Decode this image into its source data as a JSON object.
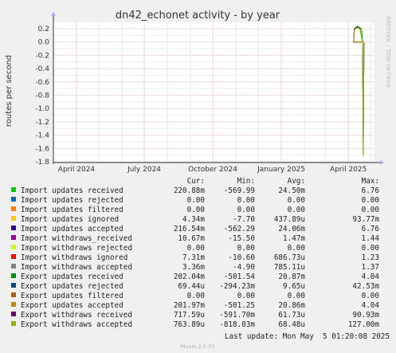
{
  "chart_data": {
    "type": "line",
    "title": "dn42_echonet activity - by year",
    "ylabel": "routes per second",
    "side_label": "RRDTOOL / TOBI OETIKER",
    "ylim": [
      -1.8,
      0.3
    ],
    "y_ticks": [
      0.2,
      0.0,
      -0.2,
      -0.4,
      -0.6,
      -0.8,
      -1.0,
      -1.2,
      -1.4,
      -1.6,
      -1.8
    ],
    "y_tick_labels": [
      "0.2",
      "0.0",
      "-0.2",
      "-0.4",
      "-0.6",
      "-0.8",
      "-1.0",
      "-1.2",
      "-1.4",
      "-1.6",
      "-1.8"
    ],
    "x_start": "2024-03-01",
    "x_end": "2025-05-05",
    "x_ticks": [
      {
        "label": "April 2024",
        "date": "2024-04-01"
      },
      {
        "label": "July 2024",
        "date": "2024-07-01"
      },
      {
        "label": "October 2024",
        "date": "2024-10-01"
      },
      {
        "label": "January 2025",
        "date": "2025-01-01"
      },
      {
        "label": "April 2025",
        "date": "2025-04-01"
      }
    ],
    "grid": true,
    "legend_header": {
      "cur": "Cur:",
      "min": "Min:",
      "avg": "Avg:",
      "max": "Max:"
    },
    "series": [
      {
        "name": "Import updates received",
        "color": "#00cc00",
        "cur": "220.88m",
        "min": "-569.99",
        "avg": "24.50m",
        "max": "6.76",
        "points": [
          [
            "2025-04-08",
            0.0
          ],
          [
            "2025-04-09",
            0.2
          ],
          [
            "2025-04-13",
            0.24
          ],
          [
            "2025-04-17",
            0.21
          ],
          [
            "2025-04-19",
            0.2
          ],
          [
            "2025-04-20",
            0.0
          ]
        ]
      },
      {
        "name": "Import updates rejected",
        "color": "#0066b3",
        "cur": "0.00",
        "min": "0.00",
        "avg": "0.00",
        "max": "0.00",
        "points": [
          [
            "2025-04-08",
            0.0
          ],
          [
            "2025-04-20",
            0.0
          ]
        ]
      },
      {
        "name": "Import updates filtered",
        "color": "#ff8000",
        "cur": "0.00",
        "min": "0.00",
        "avg": "0.00",
        "max": "0.00",
        "points": [
          [
            "2025-04-08",
            0.0
          ],
          [
            "2025-04-20",
            0.0
          ]
        ]
      },
      {
        "name": "Import updates ignored",
        "color": "#ffcc00",
        "cur": "4.34m",
        "min": "-7.70",
        "avg": "437.89u",
        "max": "93.77m",
        "points": [
          [
            "2025-04-08",
            0.0
          ],
          [
            "2025-04-20",
            0.0
          ]
        ]
      },
      {
        "name": "Import updates accepted",
        "color": "#330099",
        "cur": "216.54m",
        "min": "-562.29",
        "avg": "24.06m",
        "max": "6.76",
        "points": [
          [
            "2025-04-08",
            0.0
          ],
          [
            "2025-04-09",
            0.19
          ],
          [
            "2025-04-13",
            0.23
          ],
          [
            "2025-04-17",
            0.2
          ],
          [
            "2025-04-20",
            0.0
          ]
        ]
      },
      {
        "name": "Import withdraws_received",
        "color": "#990099",
        "cur": "10.67m",
        "min": "-15.50",
        "avg": "1.47m",
        "max": "1.44",
        "points": [
          [
            "2025-04-08",
            0.0
          ],
          [
            "2025-04-20",
            0.0
          ]
        ]
      },
      {
        "name": "Import withdraws rejected",
        "color": "#ccff00",
        "cur": "0.00",
        "min": "0.00",
        "avg": "0.00",
        "max": "0.00",
        "points": [
          [
            "2025-04-08",
            0.0
          ],
          [
            "2025-04-20",
            0.0
          ]
        ]
      },
      {
        "name": "Import withdraws ignored",
        "color": "#ff0000",
        "cur": "7.31m",
        "min": "-10.60",
        "avg": "686.73u",
        "max": "1.23",
        "points": [
          [
            "2025-04-08",
            0.0
          ],
          [
            "2025-04-20",
            0.0
          ]
        ]
      },
      {
        "name": "Import withdraws accepted",
        "color": "#808080",
        "cur": "3.36m",
        "min": "-4.90",
        "avg": "785.11u",
        "max": "1.37",
        "points": [
          [
            "2025-04-08",
            0.0
          ],
          [
            "2025-04-20",
            0.0
          ]
        ]
      },
      {
        "name": "Export updates received",
        "color": "#008f00",
        "cur": "202.04m",
        "min": "-501.54",
        "avg": "20.87m",
        "max": "4.04",
        "points": [
          [
            "2025-04-08",
            0.0
          ],
          [
            "2025-04-09",
            0.18
          ],
          [
            "2025-04-13",
            0.22
          ],
          [
            "2025-04-17",
            0.19
          ],
          [
            "2025-04-20",
            0.0
          ]
        ]
      },
      {
        "name": "Export updates rejected",
        "color": "#00487d",
        "cur": "69.44u",
        "min": "-294.23m",
        "avg": "9.65u",
        "max": "42.53m",
        "points": [
          [
            "2025-04-08",
            0.0
          ],
          [
            "2025-04-20",
            0.0
          ],
          [
            "2025-04-21",
            -1.62
          ],
          [
            "2025-04-22",
            0.0
          ]
        ]
      },
      {
        "name": "Export updates filtered",
        "color": "#b35a00",
        "cur": "0.00",
        "min": "0.00",
        "avg": "0.00",
        "max": "0.00",
        "points": [
          [
            "2025-04-08",
            0.0
          ],
          [
            "2025-04-20",
            0.0
          ]
        ]
      },
      {
        "name": "Export updates accepted",
        "color": "#b38f00",
        "cur": "201.97m",
        "min": "-501.25",
        "avg": "20.86m",
        "max": "4.04",
        "points": [
          [
            "2025-04-08",
            0.0
          ],
          [
            "2025-04-09",
            0.18
          ],
          [
            "2025-04-13",
            0.22
          ],
          [
            "2025-04-17",
            0.19
          ],
          [
            "2025-04-20",
            0.0
          ]
        ]
      },
      {
        "name": "Export withdraws received",
        "color": "#6b006b",
        "cur": "717.59u",
        "min": "-591.70m",
        "avg": "61.73u",
        "max": "90.93m",
        "points": [
          [
            "2025-04-08",
            0.0
          ],
          [
            "2025-04-20",
            0.0
          ],
          [
            "2025-04-21",
            -1.68
          ],
          [
            "2025-04-22",
            0.0
          ]
        ]
      },
      {
        "name": "Export withdraws accepted",
        "color": "#8fb300",
        "cur": "763.89u",
        "min": "-818.03m",
        "avg": "68.48u",
        "max": "127.00m",
        "points": [
          [
            "2025-04-08",
            0.0
          ],
          [
            "2025-04-20",
            0.0
          ],
          [
            "2025-04-21",
            -1.72
          ],
          [
            "2025-04-22",
            0.0
          ]
        ]
      }
    ],
    "last_update": "Last update: Mon May  5 01:20:08 2025",
    "footer": "Munin 2.0.73"
  }
}
